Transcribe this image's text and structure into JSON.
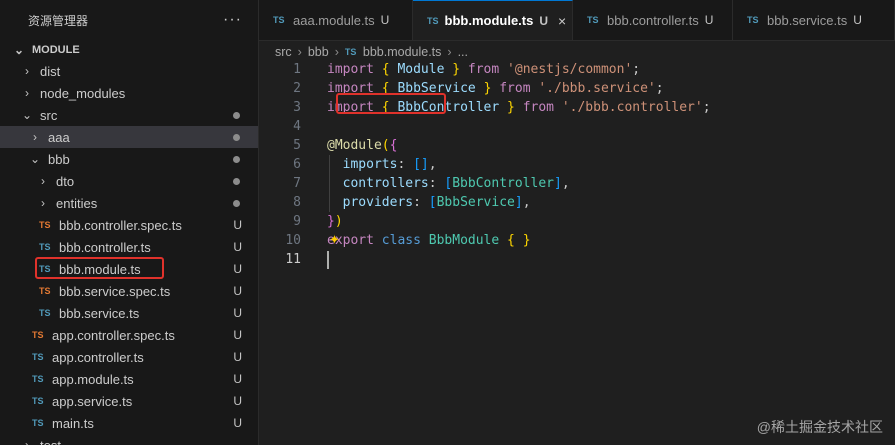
{
  "sidebar": {
    "title": "资源管理器",
    "more_icon": "more-horizontal-icon",
    "section": "MODULE",
    "items": [
      {
        "label": "dist",
        "type": "folder",
        "expanded": false,
        "indent": 0,
        "status": ""
      },
      {
        "label": "node_modules",
        "type": "folder",
        "expanded": false,
        "indent": 0,
        "status": ""
      },
      {
        "label": "src",
        "type": "folder",
        "expanded": true,
        "indent": 0,
        "status": "dot"
      },
      {
        "label": "aaa",
        "type": "folder",
        "expanded": false,
        "indent": 1,
        "status": "dot",
        "selected": true
      },
      {
        "label": "bbb",
        "type": "folder",
        "expanded": true,
        "indent": 1,
        "status": "dot"
      },
      {
        "label": "dto",
        "type": "folder",
        "expanded": false,
        "indent": 2,
        "status": "dot"
      },
      {
        "label": "entities",
        "type": "folder",
        "expanded": false,
        "indent": 2,
        "status": "dot"
      },
      {
        "label": "bbb.controller.spec.ts",
        "type": "file",
        "badge": "TS",
        "badge_color": "orange",
        "indent": 2,
        "status": "U"
      },
      {
        "label": "bbb.controller.ts",
        "type": "file",
        "badge": "TS",
        "badge_color": "blue",
        "indent": 2,
        "status": "U"
      },
      {
        "label": "bbb.module.ts",
        "type": "file",
        "badge": "TS",
        "badge_color": "blue",
        "indent": 2,
        "status": "U"
      },
      {
        "label": "bbb.service.spec.ts",
        "type": "file",
        "badge": "TS",
        "badge_color": "orange",
        "indent": 2,
        "status": "U"
      },
      {
        "label": "bbb.service.ts",
        "type": "file",
        "badge": "TS",
        "badge_color": "blue",
        "indent": 2,
        "status": "U"
      },
      {
        "label": "app.controller.spec.ts",
        "type": "file",
        "badge": "TS",
        "badge_color": "orange",
        "indent": 1,
        "status": "U"
      },
      {
        "label": "app.controller.ts",
        "type": "file",
        "badge": "TS",
        "badge_color": "blue",
        "indent": 1,
        "status": "U"
      },
      {
        "label": "app.module.ts",
        "type": "file",
        "badge": "TS",
        "badge_color": "blue",
        "indent": 1,
        "status": "U"
      },
      {
        "label": "app.service.ts",
        "type": "file",
        "badge": "TS",
        "badge_color": "blue",
        "indent": 1,
        "status": "U"
      },
      {
        "label": "main.ts",
        "type": "file",
        "badge": "TS",
        "badge_color": "blue",
        "indent": 1,
        "status": "U"
      },
      {
        "label": "test",
        "type": "folder",
        "expanded": false,
        "indent": 0,
        "status": ""
      }
    ]
  },
  "tabs": [
    {
      "badge": "TS",
      "label": "aaa.module.ts",
      "status": "U",
      "active": false
    },
    {
      "badge": "TS",
      "label": "bbb.module.ts",
      "status": "U",
      "active": true,
      "close": "×"
    },
    {
      "badge": "TS",
      "label": "bbb.controller.ts",
      "status": "U",
      "active": false
    },
    {
      "badge": "TS",
      "label": "bbb.service.ts",
      "status": "U",
      "active": false
    }
  ],
  "breadcrumb": {
    "parts": [
      "src",
      "bbb"
    ],
    "file_badge": "TS",
    "file": "bbb.module.ts",
    "tail": "..."
  },
  "code": {
    "current_line": 11,
    "lines": [
      {
        "n": "1",
        "tokens": [
          [
            "kw2",
            "import"
          ],
          [
            "tx",
            " "
          ],
          [
            "br1",
            "{"
          ],
          [
            "tx",
            " "
          ],
          [
            "cls",
            "Module"
          ],
          [
            "tx",
            " "
          ],
          [
            "br1",
            "}"
          ],
          [
            "tx",
            " "
          ],
          [
            "kw2",
            "from"
          ],
          [
            "tx",
            " "
          ],
          [
            "str",
            "'@nestjs/common'"
          ],
          [
            "tx",
            ";"
          ]
        ]
      },
      {
        "n": "2",
        "tokens": [
          [
            "kw2",
            "import"
          ],
          [
            "tx",
            " "
          ],
          [
            "br1",
            "{"
          ],
          [
            "tx",
            " "
          ],
          [
            "cls",
            "BbbService"
          ],
          [
            "tx",
            " "
          ],
          [
            "br1",
            "}"
          ],
          [
            "tx",
            " "
          ],
          [
            "kw2",
            "from"
          ],
          [
            "tx",
            " "
          ],
          [
            "str",
            "'./bbb.service'"
          ],
          [
            "tx",
            ";"
          ]
        ]
      },
      {
        "n": "3",
        "tokens": [
          [
            "kw2",
            "import"
          ],
          [
            "tx",
            " "
          ],
          [
            "br1",
            "{"
          ],
          [
            "tx",
            " "
          ],
          [
            "cls",
            "BbbController"
          ],
          [
            "tx",
            " "
          ],
          [
            "br1",
            "}"
          ],
          [
            "tx",
            " "
          ],
          [
            "kw2",
            "from"
          ],
          [
            "tx",
            " "
          ],
          [
            "str",
            "'./bbb.controller'"
          ],
          [
            "tx",
            ";"
          ]
        ]
      },
      {
        "n": "4",
        "tokens": []
      },
      {
        "n": "5",
        "tokens": [
          [
            "fn",
            "@Module"
          ],
          [
            "br1",
            "("
          ],
          [
            "br2",
            "{"
          ]
        ]
      },
      {
        "n": "6",
        "tokens": [
          [
            "tx",
            "  "
          ],
          [
            "prop",
            "imports"
          ],
          [
            "tx",
            ": "
          ],
          [
            "br3",
            "[]"
          ],
          [
            "tx",
            ","
          ]
        ]
      },
      {
        "n": "7",
        "tokens": [
          [
            "tx",
            "  "
          ],
          [
            "prop",
            "controllers"
          ],
          [
            "tx",
            ": "
          ],
          [
            "br3",
            "["
          ],
          [
            "typ",
            "BbbController"
          ],
          [
            "br3",
            "]"
          ],
          [
            "tx",
            ","
          ]
        ]
      },
      {
        "n": "8",
        "tokens": [
          [
            "tx",
            "  "
          ],
          [
            "prop",
            "providers"
          ],
          [
            "tx",
            ": "
          ],
          [
            "br3",
            "["
          ],
          [
            "typ",
            "BbbService"
          ],
          [
            "br3",
            "]"
          ],
          [
            "tx",
            ","
          ]
        ]
      },
      {
        "n": "9",
        "tokens": [
          [
            "br2",
            "}"
          ],
          [
            "br1",
            ")"
          ]
        ]
      },
      {
        "n": "10",
        "tokens": [
          [
            "kw2",
            "ex"
          ],
          [
            "kw2",
            "port"
          ],
          [
            "tx",
            " "
          ],
          [
            "kw",
            "class"
          ],
          [
            "tx",
            " "
          ],
          [
            "typ",
            "BbbModule"
          ],
          [
            "tx",
            " "
          ],
          [
            "br1",
            "{"
          ],
          [
            "tx",
            " "
          ],
          [
            "br1",
            "}"
          ]
        ]
      },
      {
        "n": "11",
        "tokens": []
      }
    ]
  },
  "icons": {
    "lightbulb": "lightbulb-icon",
    "chevron_right": "chevron-right-icon",
    "chevron_down": "chevron-down-icon"
  },
  "colors": {
    "highlight_box": "#e0322b",
    "ts_blue": "#519aba",
    "ts_orange": "#e37933"
  },
  "watermark": "@稀土掘金技术社区"
}
